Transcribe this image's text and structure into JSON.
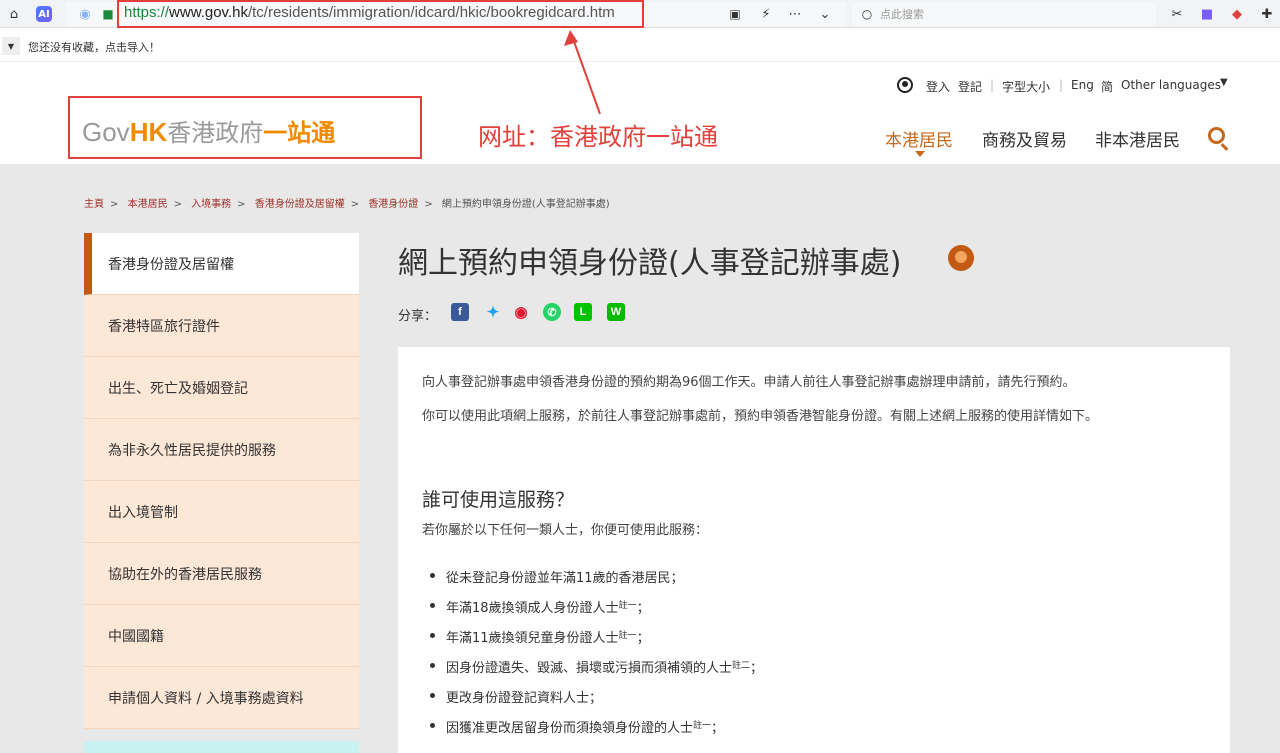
{
  "browser": {
    "url_scheme": "https://",
    "url_host": "www.gov.hk",
    "url_path": "/tc/residents/immigration/idcard/hkic/bookregidcard.htm",
    "search_placeholder": "点此搜索",
    "bookmark_prompt": "您还没有收藏，点击导入！"
  },
  "annotation": {
    "label": "网址：香港政府一站通"
  },
  "logo": {
    "gov": "Gov",
    "hk": "HK",
    "cn_plain": "香港政府",
    "cn_highlight": "一站通"
  },
  "utility": {
    "login": "登入",
    "register": "登記",
    "font_size": "字型大小",
    "eng": "Eng",
    "simplified": "简",
    "other_languages": "Other languages"
  },
  "nav": {
    "residents": "本港居民",
    "business": "商務及貿易",
    "non_residents": "非本港居民"
  },
  "breadcrumb": [
    "主頁",
    "本港居民",
    "入境事務",
    "香港身份證及居留權",
    "香港身份證",
    "網上預約申領身份證(人事登記辦事處)"
  ],
  "sidebar": {
    "items": [
      {
        "label": "香港身份證及居留權"
      },
      {
        "label": "香港特區旅行證件"
      },
      {
        "label": "出生、死亡及婚姻登記"
      },
      {
        "label": "為非永久性居民提供的服務"
      },
      {
        "label": "出入境管制"
      },
      {
        "label": "協助在外的香港居民服務"
      },
      {
        "label": "中國國籍"
      },
      {
        "label": "申請個人資料 / 入境事務處資料"
      }
    ]
  },
  "content": {
    "title": "網上預約申領身份證(人事登記辦事處)",
    "share_label": "分享：",
    "para1": "向人事登記辦事處申領香港身份證的預約期為96個工作天。申請人前往人事登記辦事處辦理申請前，請先行預約。",
    "para2": "你可以使用此項網上服務，於前往人事登記辦事處前，預約申領香港智能身份證。有關上述網上服務的使用詳情如下。",
    "heading": "誰可使用這服務？",
    "intro": "若你屬於以下任何一類人士，你便可使用此服務：",
    "bullets": [
      {
        "text": "從未登記身份證並年滿11歲的香港居民；",
        "note": ""
      },
      {
        "text": "年滿18歲換領成人身份證人士",
        "note": "註一",
        "tail": "；"
      },
      {
        "text": "年滿11歲換領兒童身份證人士",
        "note": "註一",
        "tail": "；"
      },
      {
        "text": "因身份證遺失、毀滅、損壞或污損而須補領的人士",
        "note": "註二",
        "tail": "；"
      },
      {
        "text": "更改身份證登記資料人士；",
        "note": ""
      },
      {
        "text": "因獲准更改居留身份而須換領身份證的人士",
        "note": "註一",
        "tail": "；"
      }
    ]
  },
  "colors": {
    "accent": "#c7671a",
    "annotation_red": "#e2403a",
    "sidebar_bg": "#fde8d8",
    "main_bg": "#e8e8e8"
  }
}
